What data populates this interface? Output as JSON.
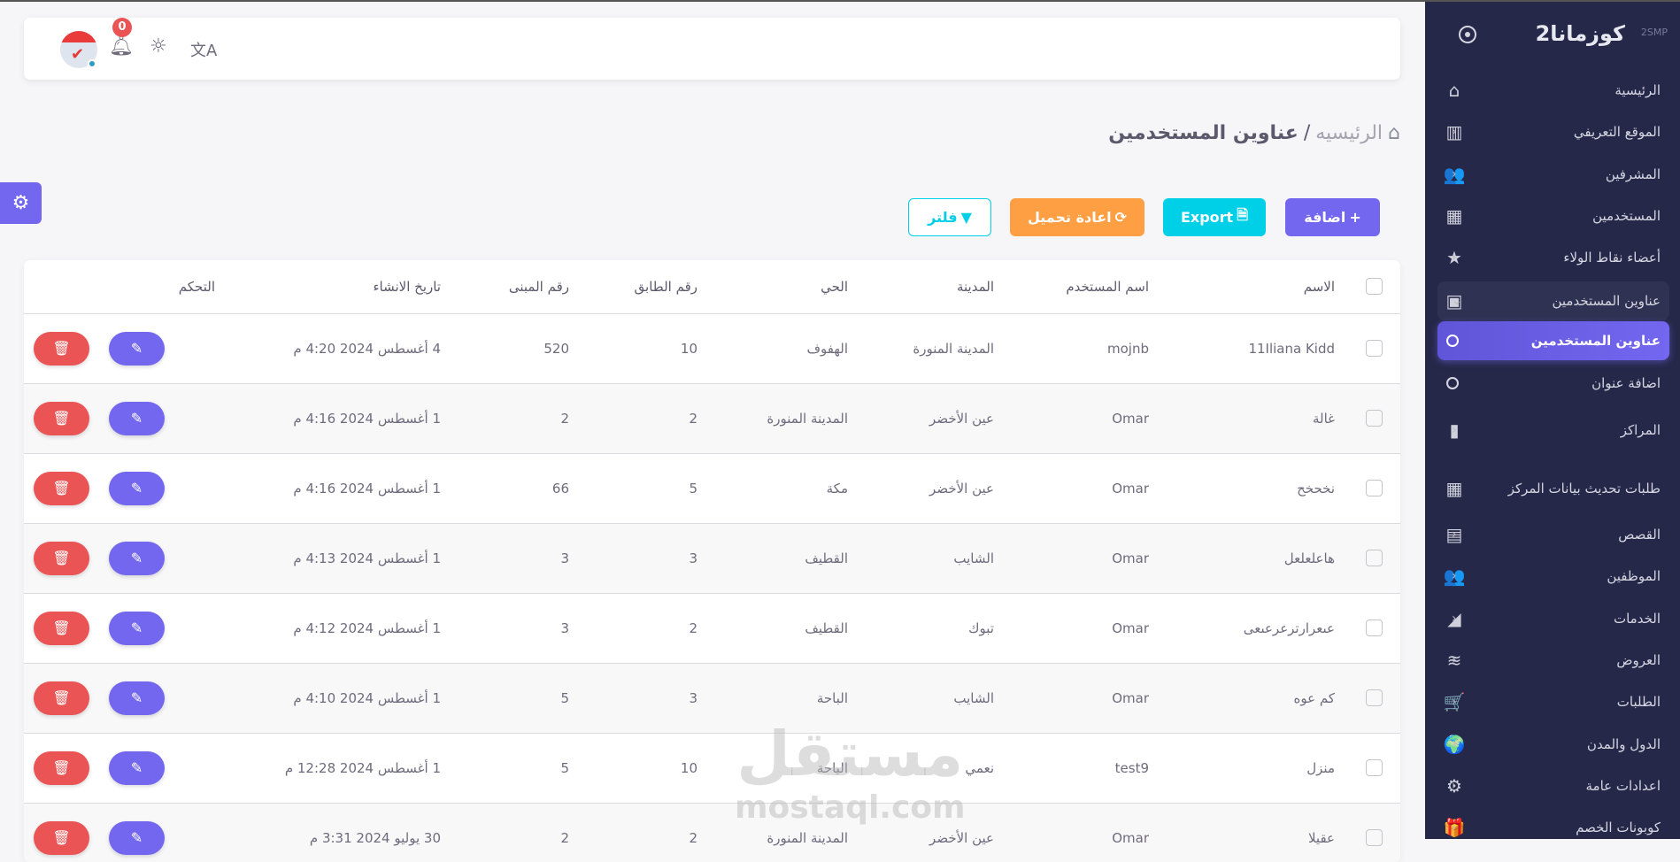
{
  "sidebar": {
    "brand": "كوزمانا2",
    "brand_mark": "2SMP",
    "items": [
      {
        "label": "الرئيسية",
        "icon": "home-icon",
        "glyph": "⌂",
        "chevron": false
      },
      {
        "label": "الموقع التعريفي",
        "icon": "map-icon",
        "glyph": "▥",
        "chevron": true
      },
      {
        "label": "المشرفين",
        "icon": "users-cog-icon",
        "glyph": "👥",
        "chevron": true
      },
      {
        "label": "المستخدمين",
        "icon": "building-user-icon",
        "glyph": "▦",
        "chevron": true
      },
      {
        "label": "أعضاء نقاط الولاء",
        "icon": "star-icon",
        "glyph": "★",
        "chevron": true
      },
      {
        "label": "عناوين المستخدمين",
        "icon": "address-book-icon",
        "glyph": "▣",
        "chevron": true,
        "expanded": true
      },
      {
        "label": "عناوين المستخدمين",
        "sub": true,
        "active": true
      },
      {
        "label": "اضافة عنوان",
        "sub": true
      },
      {
        "label": "المراكز",
        "icon": "door-icon",
        "glyph": "▮",
        "chevron": true
      },
      {
        "label": "طلبات تحديث بيانات المركز",
        "icon": "building-user-icon",
        "glyph": "▦",
        "chevron": true
      },
      {
        "label": "القصص",
        "icon": "film-icon",
        "glyph": "▤",
        "chevron": true
      },
      {
        "label": "الموظفين",
        "icon": "users-icon",
        "glyph": "👥",
        "chevron": true
      },
      {
        "label": "الخدمات",
        "icon": "services-icon",
        "glyph": "◢",
        "chevron": true
      },
      {
        "label": "العروض",
        "icon": "layers-icon",
        "glyph": "≋",
        "chevron": true
      },
      {
        "label": "الطلبات",
        "icon": "cart-icon",
        "glyph": "🛒",
        "chevron": true
      },
      {
        "label": "الدول والمدن",
        "icon": "globe-icon",
        "glyph": "🌍",
        "chevron": true
      },
      {
        "label": "اعدادات عامة",
        "icon": "gear-icon",
        "glyph": "⚙",
        "chevron": true
      },
      {
        "label": "كوبونات الخصم",
        "icon": "gift-icon",
        "glyph": "🎁",
        "chevron": true
      }
    ]
  },
  "topbar": {
    "notifications": "0"
  },
  "breadcrumb": {
    "home": "الرئيسيه",
    "separator": "/",
    "current": "عناوين المستخدمين"
  },
  "toolbar": {
    "add": "اضافة",
    "export": "Export",
    "reload": "اعادة تحميل",
    "filter": "فلتر"
  },
  "table": {
    "headers": [
      "الاسم",
      "اسم المستخدم",
      "المدينة",
      "الحي",
      "رقم الطابق",
      "رقم المبنى",
      "تاريخ الانشاء",
      "التحكم"
    ],
    "rows": [
      [
        "11Iliana Kidd",
        "mojnb",
        "المدينة المنورة",
        "الهفوف",
        "10",
        "520",
        "4 أغسطس 2024 4:20 م"
      ],
      [
        "غالة",
        "Omar",
        "عين الأخضر",
        "المدينة المنورة",
        "2",
        "2",
        "1 أغسطس 2024 4:16 م"
      ],
      [
        "نخحخح",
        "Omar",
        "عين الأخضر",
        "مكة",
        "5",
        "66",
        "1 أغسطس 2024 4:16 م"
      ],
      [
        "هاعلعلعل",
        "Omar",
        "الشايب",
        "القطيف",
        "3",
        "3",
        "1 أغسطس 2024 4:13 م"
      ],
      [
        "عىعرارترعرعىعى",
        "Omar",
        "تبوك",
        "القطيف",
        "2",
        "3",
        "1 أغسطس 2024 4:12 م"
      ],
      [
        "كم عوه",
        "Omar",
        "الشايب",
        "الباحة",
        "3",
        "5",
        "1 أغسطس 2024 4:10 م"
      ],
      [
        "منزل",
        "test9",
        "نعمي",
        "الباحة",
        "10",
        "5",
        "1 أغسطس 2024 12:28 م"
      ],
      [
        "عقيلا",
        "Omar",
        "عين الأخضر",
        "المدينة المنورة",
        "2",
        "2",
        "30 يوليو 2024 3:31 م"
      ]
    ]
  },
  "watermark": {
    "ar": "مستقل",
    "en": "mostaql.com"
  }
}
